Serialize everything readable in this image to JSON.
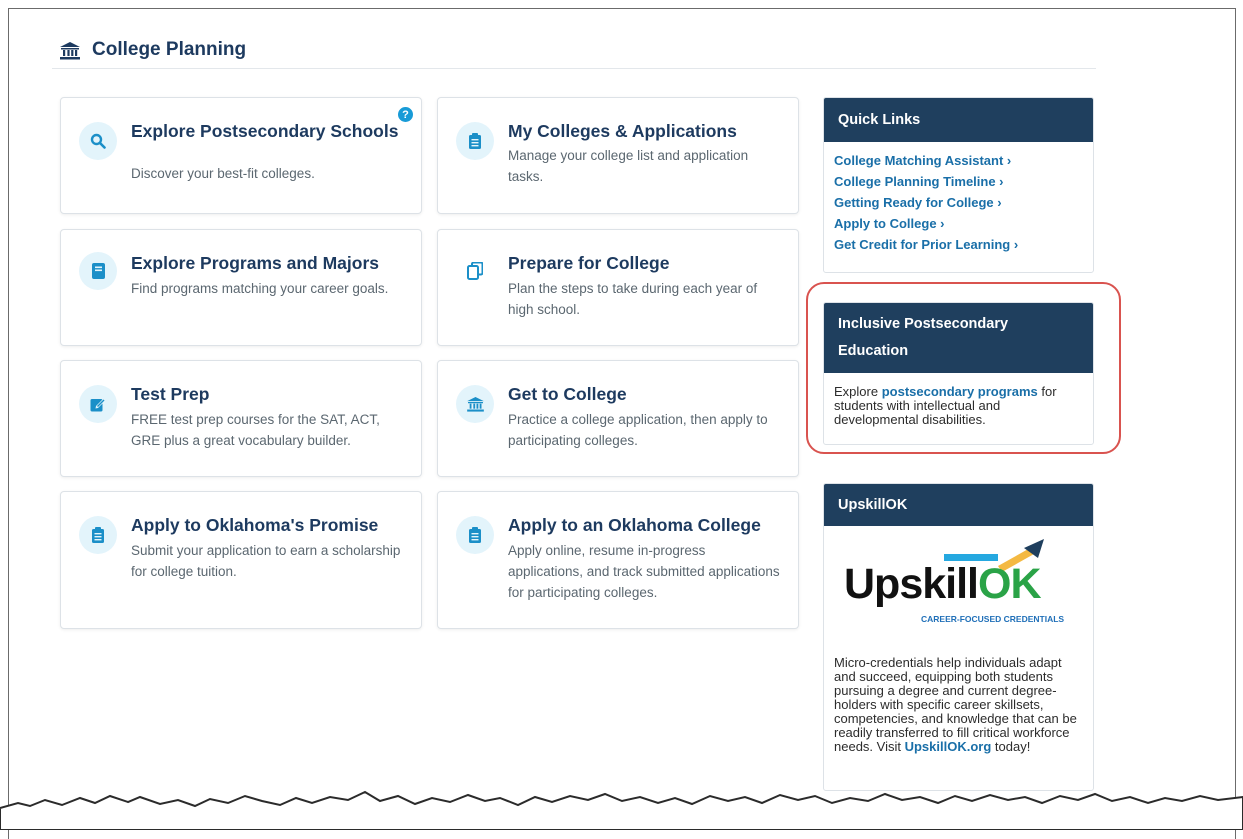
{
  "section": {
    "title": "College Planning",
    "icon": "bank-icon"
  },
  "cards": [
    {
      "title": "Explore Postsecondary Schools",
      "desc": "Discover your best-fit colleges.",
      "icon": "search-icon"
    },
    {
      "title": "My Colleges & Applications",
      "desc": "Manage your college list and application tasks.",
      "icon": "clipboard-icon"
    },
    {
      "title": "Explore Programs and Majors",
      "desc": "Find programs matching your career goals.",
      "icon": "book-icon"
    },
    {
      "title": "Prepare for College",
      "desc": "Plan the steps to take during each year of high school.",
      "icon": "copy-icon"
    },
    {
      "title": "Test Prep",
      "desc": "FREE test prep courses for the SAT, ACT, GRE plus a great vocabulary builder.",
      "icon": "edit-icon"
    },
    {
      "title": "Get to College",
      "desc": "Practice a college application, then apply to participating colleges.",
      "icon": "bank-icon"
    },
    {
      "title": "Apply to Oklahoma's Promise",
      "desc": "Submit your application to earn a scholarship for college tuition.",
      "icon": "clipboard-icon"
    },
    {
      "title": "Apply to an Oklahoma College",
      "desc": "Apply online, resume in-progress applications, and track submitted applications for participating colleges.",
      "icon": "clipboard-icon"
    }
  ],
  "help": {
    "symbol": "?"
  },
  "quick_links": {
    "title": "Quick Links",
    "items": [
      "College Matching Assistant ›",
      "College Planning Timeline ›",
      "Getting Ready for College ›",
      "Apply to College ›",
      "Get Credit for Prior Learning ›"
    ]
  },
  "inclusive": {
    "title": "Inclusive Postsecondary Education",
    "text_before": "Explore ",
    "link": "postsecondary programs",
    "text_after": " for students with intellectual and developmental disabilities."
  },
  "upskill": {
    "title": "UpskillOK",
    "logo_word": "Upskill",
    "logo_ok": "OK",
    "logo_tagline": "CAREER-FOCUSED CREDENTIALS",
    "text_before": "Micro-credentials help individuals adapt and succeed, equipping both students pursuing a degree and current degree-holders with specific career skillsets, competencies, and knowledge that can be readily transferred to fill critical workforce needs. Visit ",
    "link": "UpskillOK.org",
    "text_after": " today!"
  },
  "colors": {
    "navy": "#1f3f5e",
    "accent": "#189bd7",
    "link": "#1a6fa8",
    "highlight": "#d9534f"
  }
}
